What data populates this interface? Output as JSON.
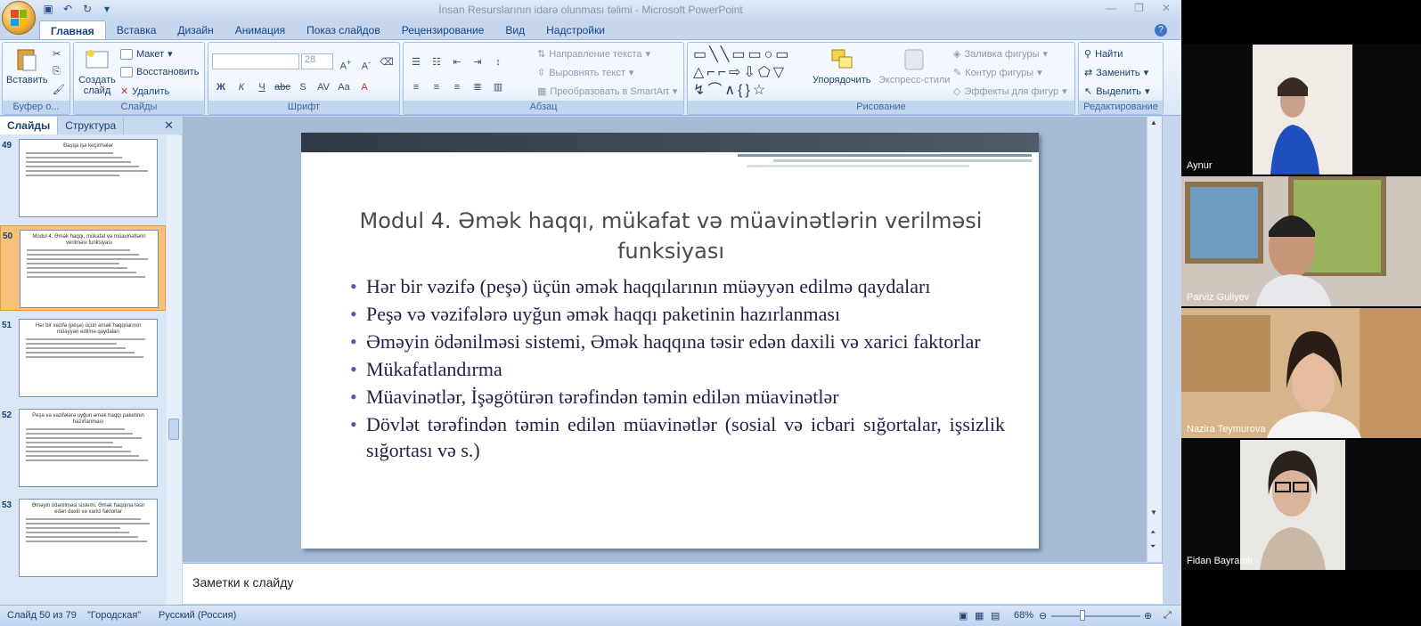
{
  "window": {
    "title": "İnsan Resurslarının idarə olunması təlimi - Microsoft PowerPoint"
  },
  "ribbon": {
    "tabs": [
      "Главная",
      "Вставка",
      "Дизайн",
      "Анимация",
      "Показ слайдов",
      "Рецензирование",
      "Вид",
      "Надстройки"
    ],
    "active_tab": "Главная",
    "clipboard": {
      "label": "Буфер о...",
      "paste": "Вставить"
    },
    "slides": {
      "label": "Слайды",
      "new_slide": "Создать слайд",
      "layout": "Макет",
      "reset": "Восстановить",
      "delete": "Удалить"
    },
    "font": {
      "label": "Шрифт",
      "size": "28"
    },
    "paragraph": {
      "label": "Абзац",
      "text_direction": "Направление текста",
      "align_text": "Выровнять текст",
      "convert_smartart": "Преобразовать в SmartArt"
    },
    "drawing": {
      "label": "Рисование",
      "arrange": "Упорядочить",
      "quick_styles": "Экспресс-стили",
      "shape_fill": "Заливка фигуры",
      "shape_outline": "Контур фигуры",
      "shape_effects": "Эффекты для фигур"
    },
    "editing": {
      "label": "Редактирование",
      "find": "Найти",
      "replace": "Заменить",
      "select": "Выделить"
    }
  },
  "left_pane": {
    "tabs": [
      "Слайды",
      "Структура"
    ],
    "thumbnails": [
      {
        "num": "49",
        "title": "Başqa işə keçirmələr",
        "lines": 6
      },
      {
        "num": "50",
        "title": "Modul 4. Əmək haqqı, mükafat və müavinətlərin verilməsi funksiyası",
        "lines": 7,
        "selected": true
      },
      {
        "num": "51",
        "title": "Hər bir vəzifə (peşə) üçün əmək haqqılarının müəyyən edilmə qaydaları",
        "lines": 5
      },
      {
        "num": "52",
        "title": "Peşə və vəzifələrə uyğun əmək haqqı paketinin hazırlanması",
        "lines": 8
      },
      {
        "num": "53",
        "title": "Əməyin ödənilməsi sistemi, Əmək haqqına təsir edən daxili və xarici faktorlar",
        "lines": 6
      }
    ]
  },
  "slide": {
    "title": "Modul 4. Əmək haqqı, mükafat və müavinətlərin verilməsi funksiyası",
    "bullets": [
      "Hər bir vəzifə (peşə) üçün əmək haqqılarının müəyyən edilmə qaydaları",
      "Peşə və vəzifələrə uyğun əmək haqqı paketinin hazırlanması",
      "Əməyin ödənilməsi sistemi, Əmək haqqına təsir edən daxili və xarici faktorlar",
      "Mükafatlandırma",
      "Müavinətlər, İşəgötürən tərəfindən təmin edilən müavinətlər",
      "Dövlət tərəfindən təmin edilən müavinətlər (sosial və icbari sığortalar, işsizlik sığortası və s.)"
    ]
  },
  "notes": {
    "placeholder": "Заметки к слайду"
  },
  "statusbar": {
    "slide_info": "Слайд 50 из 79",
    "theme": "\"Городская\"",
    "language": "Русский (Россия)",
    "zoom": "68%"
  },
  "participants": [
    {
      "name": "Aynur"
    },
    {
      "name": "Parviz Guliyev"
    },
    {
      "name": "Nazira Teymurova"
    },
    {
      "name": "Fidan Bayramlı"
    }
  ]
}
